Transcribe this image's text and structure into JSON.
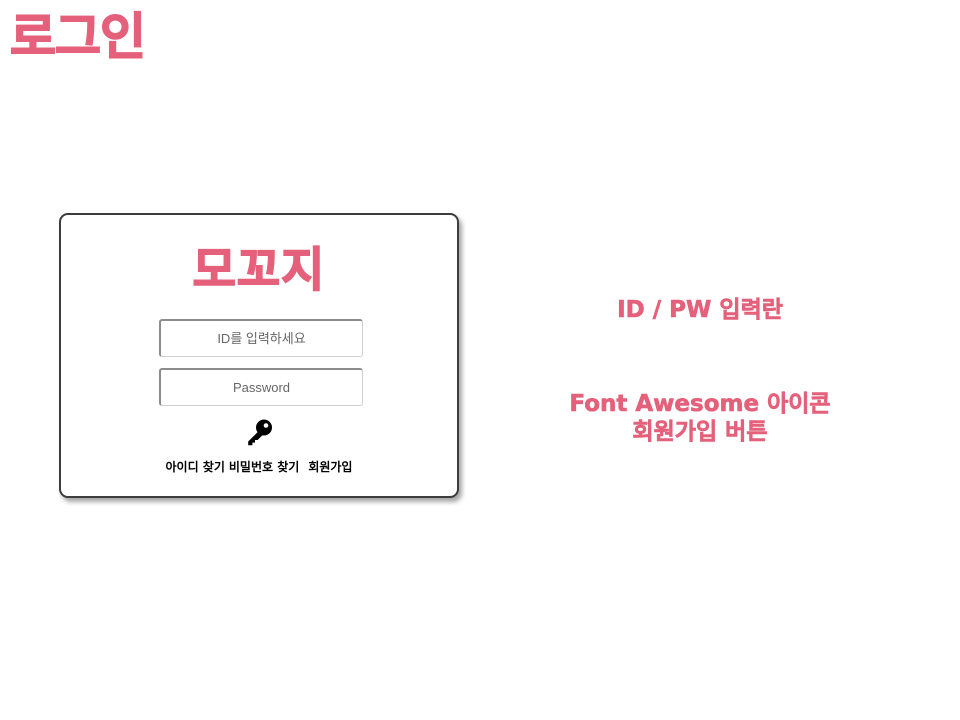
{
  "page": {
    "title": "로그인"
  },
  "login_card": {
    "brand": "모꼬지",
    "id_placeholder": "ID를 입력하세요",
    "password_placeholder": "Password",
    "key_icon": "key-icon",
    "links": {
      "find_id": "아이디 찾기",
      "find_password": "비밀번호 찾기",
      "signup": "회원가입"
    }
  },
  "annotations": {
    "inputs_note": "ID / PW 입력란",
    "icon_note_line1": "Font Awesome 아이콘",
    "icon_note_line2": "회원가입 버튼"
  },
  "colors": {
    "accent": "#e4607b",
    "card_border": "#3d3d3d",
    "text": "#000000"
  }
}
